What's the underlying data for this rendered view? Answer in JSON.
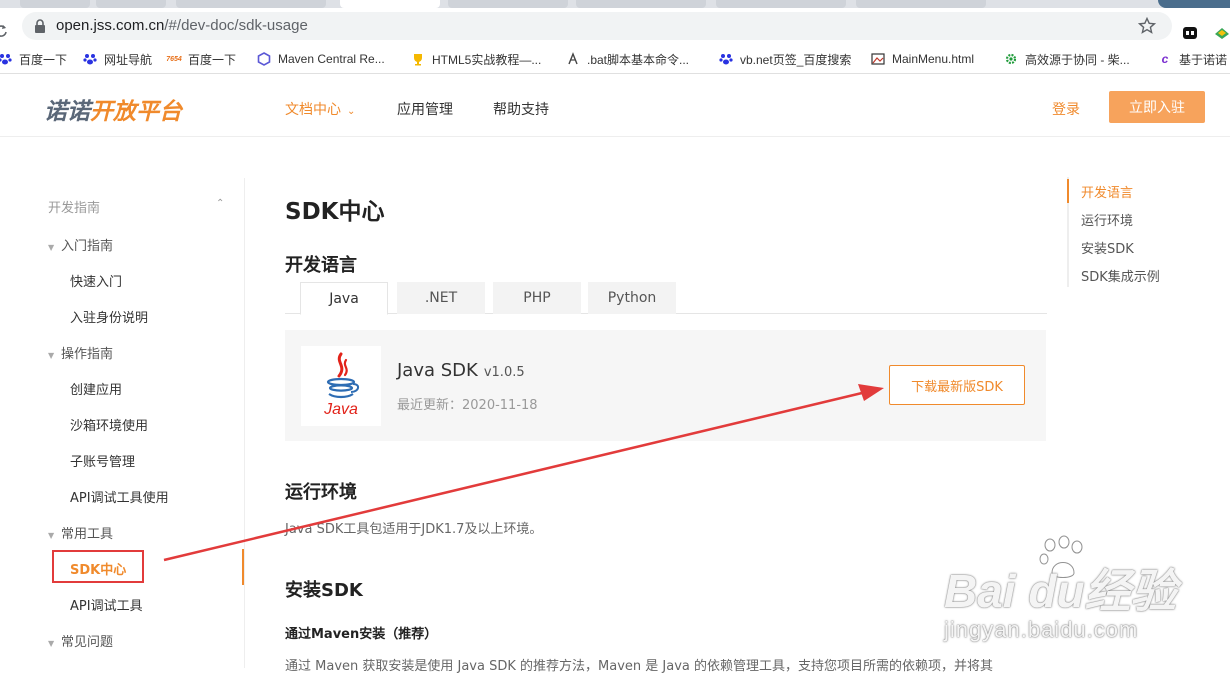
{
  "browser": {
    "url_host": "open.jss.com.cn",
    "url_path": "/#/dev-doc/sdk-usage",
    "bookmarks": [
      {
        "label": "百度一下",
        "icon": "baidu-paw-icon"
      },
      {
        "label": "网址导航",
        "icon": "baidu-paw-icon"
      },
      {
        "label": "百度一下",
        "icon": "7654-icon"
      },
      {
        "label": "Maven Central Re...",
        "icon": "hexagon-icon"
      },
      {
        "label": "HTML5实战教程—...",
        "icon": "trophy-icon"
      },
      {
        "label": ".bat脚本基本命令...",
        "icon": "page-icon"
      },
      {
        "label": "vb.net页签_百度搜索",
        "icon": "baidu-paw-icon"
      },
      {
        "label": "MainMenu.html",
        "icon": "image-icon"
      },
      {
        "label": "高效源于协同 - 柴...",
        "icon": "gear-icon"
      },
      {
        "label": "基于诺诺",
        "icon": "c-icon"
      }
    ]
  },
  "header": {
    "logo_part1": "诺诺",
    "logo_part2": "开放平台",
    "nav": [
      {
        "label": "文档中心",
        "active": true
      },
      {
        "label": "应用管理",
        "active": false
      },
      {
        "label": "帮助支持",
        "active": false
      }
    ],
    "login": "登录",
    "join": "立即入驻"
  },
  "sidebar": {
    "group_title": "开发指南",
    "sections": [
      {
        "label": "入门指南",
        "items": [
          "快速入门",
          "入驻身份说明"
        ]
      },
      {
        "label": "操作指南",
        "items": [
          "创建应用",
          "沙箱环境使用",
          "子账号管理",
          "API调试工具使用"
        ]
      },
      {
        "label": "常用工具",
        "items": [
          "SDK中心",
          "API调试工具"
        ]
      },
      {
        "label": "常见问题",
        "items": []
      }
    ],
    "active_item": "SDK中心"
  },
  "content": {
    "title": "SDK中心",
    "dev_lang_heading": "开发语言",
    "tabs": [
      "Java",
      ".NET",
      "PHP",
      "Python"
    ],
    "active_tab": "Java",
    "sdk": {
      "name": "Java SDK",
      "version": "v1.0.5",
      "updated_label": "最近更新：2020-11-18",
      "download": "下载最新版SDK",
      "logo_text": "Java"
    },
    "runtime_heading": "运行环境",
    "runtime_text": "Java SDK工具包适用于JDK1.7及以上环境。",
    "install_heading": "安装SDK",
    "maven_heading": "通过Maven安装（推荐）",
    "maven_text": "通过 Maven 获取安装是使用 Java SDK 的推荐方法，Maven 是 Java 的依赖管理工具，支持您项目所需的依赖项，并将其"
  },
  "toc": [
    "开发语言",
    "运行环境",
    "安装SDK",
    "SDK集成示例"
  ],
  "watermark": {
    "brand": "Bai du经验",
    "url": "jingyan.baidu.com"
  },
  "colors": {
    "accent": "#f08a2c",
    "annotation_red": "#e23b3b"
  }
}
